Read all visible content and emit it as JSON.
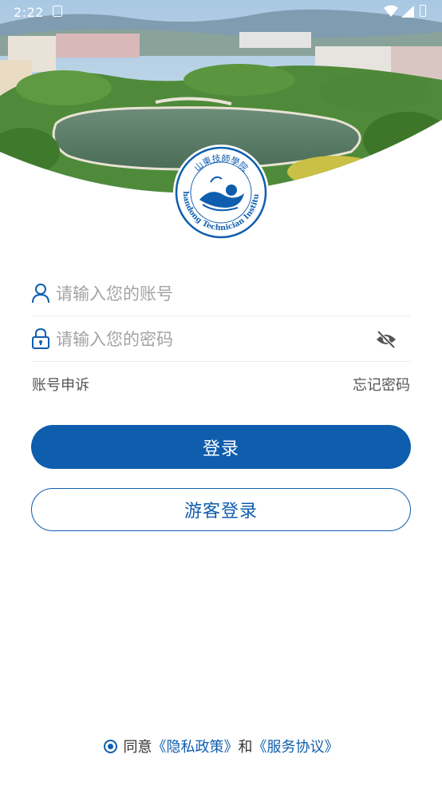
{
  "status_bar": {
    "time": "2:22"
  },
  "logo": {
    "cn_text": "山東技師學院",
    "en_text": "Shandong Technician Institute"
  },
  "form": {
    "account_placeholder": "请输入您的账号",
    "password_placeholder": "请输入您的密码",
    "appeal_label": "账号申诉",
    "forgot_label": "忘记密码",
    "login_label": "登录",
    "guest_label": "游客登录"
  },
  "agreement": {
    "agree_text": "同意",
    "privacy_link": "《隐私政策》",
    "and_text": "和",
    "service_link": "《服务协议》"
  },
  "colors": {
    "primary": "#0f5eae",
    "muted": "#a3a3a3"
  },
  "icons": [
    "user-icon",
    "lock-icon",
    "eye-off-icon",
    "wifi-icon",
    "signal-icon",
    "battery-icon",
    "notification-icon",
    "radio-checked-icon"
  ]
}
